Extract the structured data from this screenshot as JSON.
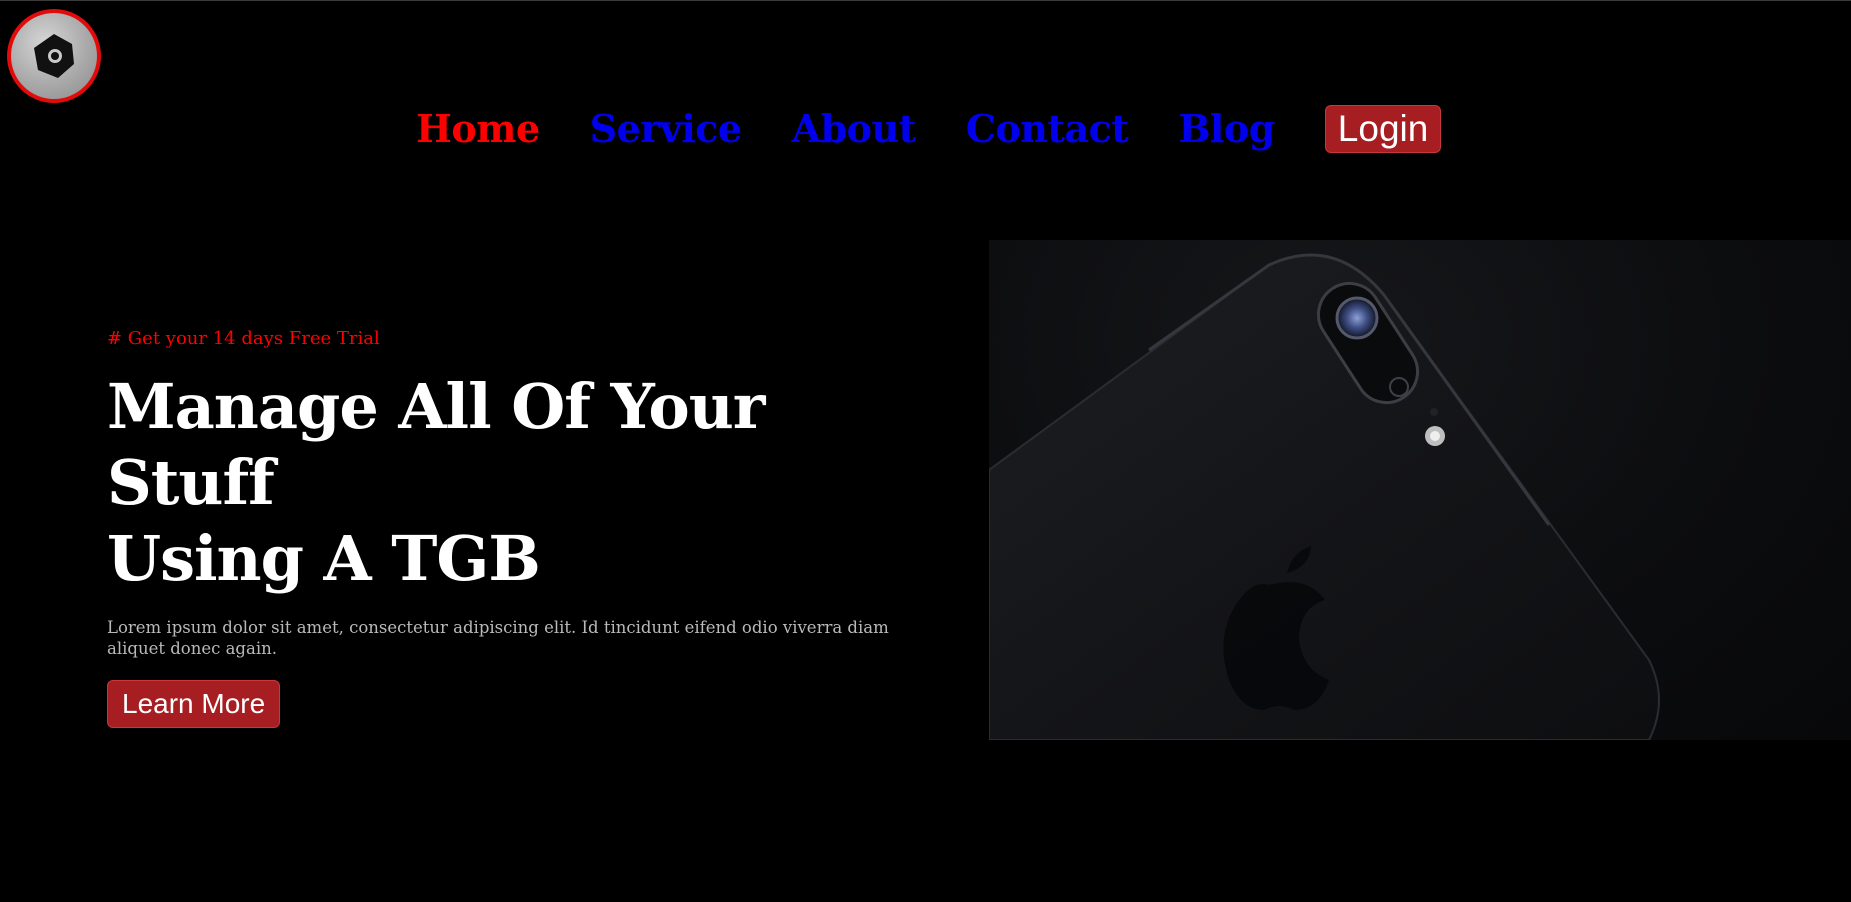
{
  "logo": {
    "icon": "camera-gear-icon"
  },
  "nav": {
    "items": [
      {
        "label": "Home",
        "active": true
      },
      {
        "label": "Service",
        "active": false
      },
      {
        "label": "About",
        "active": false
      },
      {
        "label": "Contact",
        "active": false
      },
      {
        "label": "Blog",
        "active": false
      }
    ],
    "login_label": "Login"
  },
  "hero": {
    "tagline": "# Get your 14 days Free Trial",
    "headline_line1": "Manage All Of Your Stuff",
    "headline_line2": "Using A TGB",
    "description": "Lorem ipsum dolor sit amet, consectetur adipiscing elit. Id tincidunt eifend odio viverra diam aliquet donec again.",
    "cta_label": "Learn More",
    "image_icon": "phone-image"
  },
  "colors": {
    "background": "#000000",
    "accent_red": "#ff0000",
    "link_blue": "#0000ee",
    "button_red": "#a71e22",
    "text_white": "#ffffff",
    "text_gray": "#b9b9b9"
  }
}
